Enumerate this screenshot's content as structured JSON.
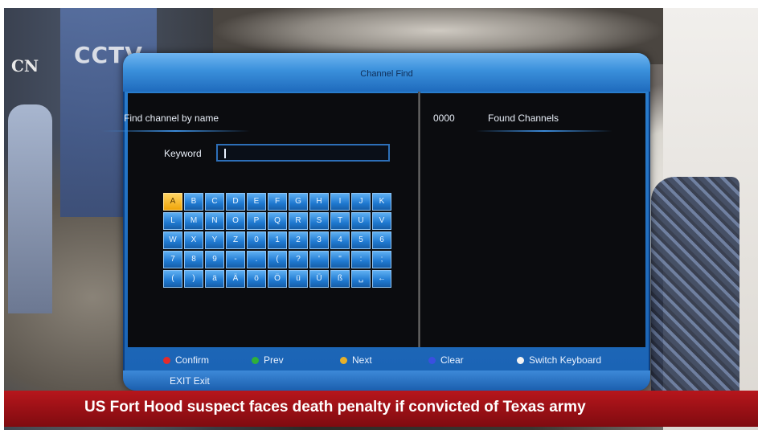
{
  "background": {
    "logos": {
      "cctv": "CCTV",
      "cn": "CN"
    }
  },
  "dialog": {
    "title": "Channel Find",
    "left_header": "Find channel by name",
    "found_count": "0000",
    "right_header": "Found Channels",
    "keyword_label": "Keyword",
    "keyword_value": "",
    "keyboard": {
      "rows": [
        [
          "A",
          "B",
          "C",
          "D",
          "E",
          "F",
          "G",
          "H",
          "I",
          "J",
          "K"
        ],
        [
          "L",
          "M",
          "N",
          "O",
          "P",
          "Q",
          "R",
          "S",
          "T",
          "U",
          "V"
        ],
        [
          "W",
          "X",
          "Y",
          "Z",
          "0",
          "1",
          "2",
          "3",
          "4",
          "5",
          "6"
        ],
        [
          "7",
          "8",
          "9",
          "-",
          ".",
          "(",
          "?",
          "'",
          "\"",
          ":",
          ";"
        ],
        [
          "(",
          ")",
          "ä",
          "Ä",
          "ö",
          "Ö",
          "ü",
          "Ü",
          "ß",
          "␣",
          "←"
        ]
      ],
      "active_key": "A"
    },
    "footer": {
      "items": [
        {
          "label": "Confirm",
          "color": "#e32b2b"
        },
        {
          "label": "Prev",
          "color": "#2fb13a"
        },
        {
          "label": "Next",
          "color": "#e6b02a"
        },
        {
          "label": "Clear",
          "color": "#3a4fe0"
        },
        {
          "label": "Switch Keyboard",
          "color": "#f2f2f2"
        }
      ]
    },
    "exit_text": "EXIT Exit"
  },
  "ticker": {
    "text": "US Fort Hood suspect faces death penalty if convicted of Texas army"
  },
  "colors": {
    "accent": "#1f79d1",
    "active_key": "#f0a50a",
    "ticker": "#b7161c"
  }
}
